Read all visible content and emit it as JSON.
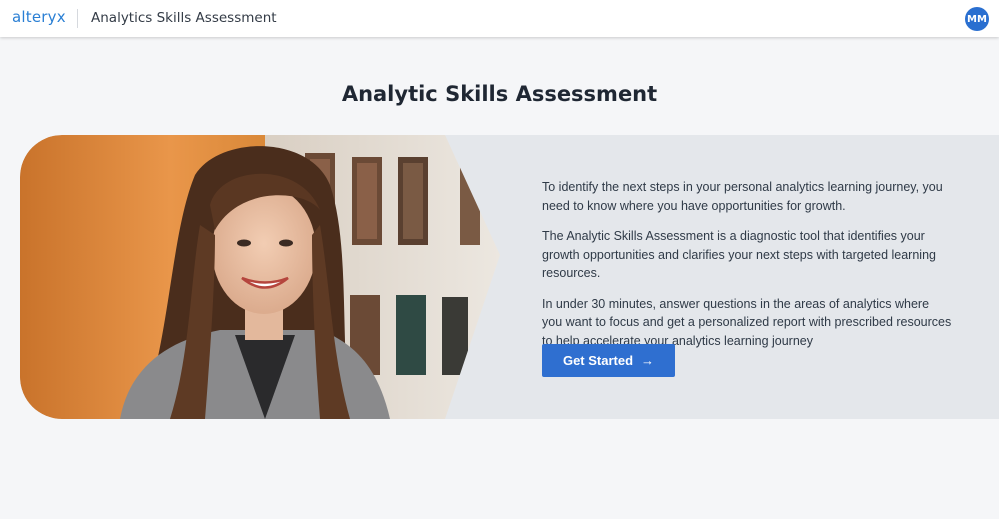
{
  "header": {
    "logo": "alteryx",
    "app_title": "Analytics Skills Assessment",
    "avatar_initials": "MM"
  },
  "main": {
    "title": "Analytic Skills Assessment",
    "paragraphs": [
      "To identify the next steps in your personal analytics learning journey, you need to know where you have opportunities for growth.",
      "The Analytic Skills Assessment is a diagnostic tool that identifies your growth opportunities and clarifies your next steps with targeted learning resources.",
      "In under 30 minutes, answer questions in the areas of analytics where you want to focus and get a personalized report with prescribed resources to help accelerate your analytics learning journey"
    ],
    "cta": {
      "label": "Get Started",
      "icon": "arrow-right-icon"
    }
  },
  "colors": {
    "brand": "#2a7fd4",
    "button": "#2f6fd0",
    "hero_panel": "#e4e7eb",
    "page_bg": "#f5f6f8"
  }
}
